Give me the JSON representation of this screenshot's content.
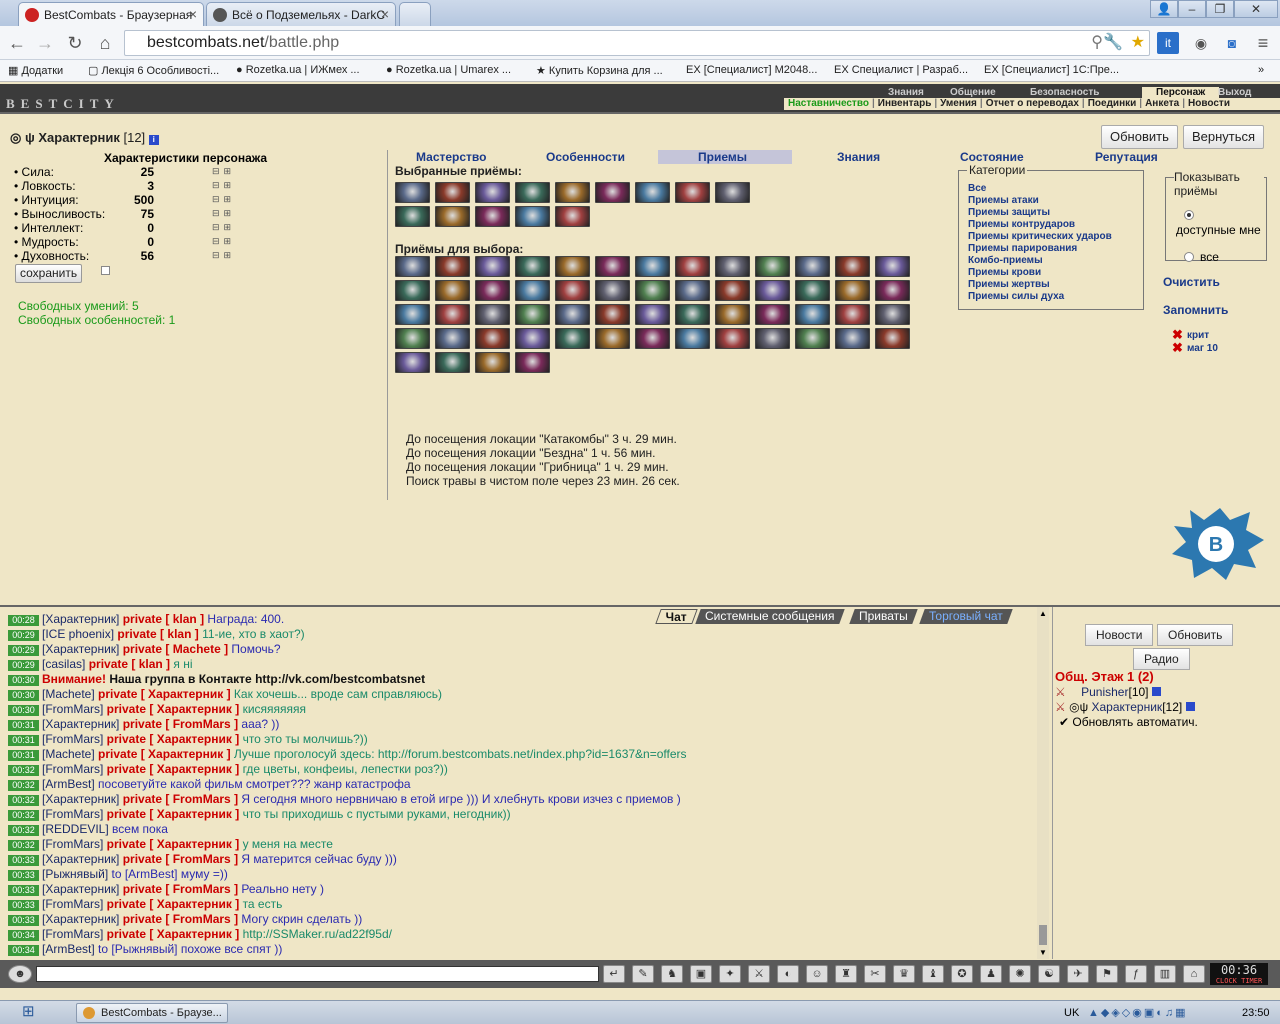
{
  "browser": {
    "tabs": [
      {
        "label": "BestCombats - Браузерная"
      },
      {
        "label": "Всё о Подземельях - DarkC"
      }
    ],
    "url_domain": "bestcombats.net",
    "url_path": "/battle.php",
    "bookmarks": [
      "Додатки",
      "Лекція 6 Особливості...",
      "Rozetka.ua | ИЖмех ...",
      "Rozetka.ua | Umarex ...",
      "Купить Корзина для ...",
      "[Специалист] M2048...",
      "Специалист | Разраб...",
      "[Специалист] 1С:Пре..."
    ]
  },
  "game": {
    "logo": "BESTCITY",
    "top_menu": [
      "Знания",
      "Общение",
      "Безопасность",
      "Персонаж",
      "Выход"
    ],
    "sub_menu": [
      "Наставничество",
      "Инвентарь",
      "Умения",
      "Отчет о переводах",
      "Поединки",
      "Анкета",
      "Новости"
    ],
    "character": {
      "name": "Характерник",
      "level": "[12]"
    },
    "buttons": {
      "refresh": "Обновить",
      "back": "Вернуться",
      "save": "сохранить"
    },
    "stats_title": "Характеристики персонажа",
    "stats": [
      {
        "name": "• Сила:",
        "value": "25"
      },
      {
        "name": "• Ловкость:",
        "value": "3"
      },
      {
        "name": "• Интуиция:",
        "value": "500"
      },
      {
        "name": "• Выносливость:",
        "value": "75"
      },
      {
        "name": "• Интеллект:",
        "value": "0"
      },
      {
        "name": "• Мудрость:",
        "value": "0"
      },
      {
        "name": "• Духовность:",
        "value": "56"
      }
    ],
    "free_skills": "Свободных умений: 5",
    "free_features": "Свободных особенностей: 1",
    "tabs": [
      "Мастерство",
      "Особенности",
      "Приемы",
      "Знания",
      "Состояние",
      "Репутация"
    ],
    "selected_title": "Выбранные приёмы:",
    "choose_title": "Приёмы для выбора:",
    "categories_title": "Категории",
    "categories": [
      "Все",
      "Приемы атаки",
      "Приемы защиты",
      "Приемы контрударов",
      "Приемы критических ударов",
      "Приемы парирования",
      "Комбо-приемы",
      "Приемы крови",
      "Приемы жертвы",
      "Приемы силы духа"
    ],
    "show_title": "Показывать приёмы",
    "show_opt1": "доступные мне",
    "show_opt2": "все",
    "clear": "Очистить",
    "remember": "Запомнить",
    "saved_sets": [
      "крит",
      "маг 10"
    ],
    "visits": [
      "До посещения локации \"Катакомбы\" 3 ч. 29 мин.",
      "До посещения локации \"Бездна\" 1 ч. 56 мин.",
      "До посещения локации \"Грибница\" 1 ч. 29 мин.",
      "Поиск травы в чистом поле через 23 мин. 26 сек."
    ]
  },
  "chat": {
    "tabs": [
      "Чат",
      "Системные сообщения",
      "Приваты",
      "Торговый чат"
    ],
    "messages": [
      {
        "time": "00:28",
        "user": "[Характерник]",
        "priv": "private [ klan ]",
        "text": "Награда: 400."
      },
      {
        "time": "00:29",
        "user": "[ICE phoenix]",
        "priv": "private [ klan ]",
        "text": "11-ие, хто в хаот?)"
      },
      {
        "time": "00:29",
        "user": "[Характерник]",
        "priv": "private [ Machete ]",
        "text": "Помочь?"
      },
      {
        "time": "00:29",
        "user": "[casilas]",
        "priv": "private [ klan ]",
        "text": "я ні"
      },
      {
        "time": "00:30",
        "user": "",
        "priv": "Внимание!",
        "text": "Наша группа в Контакте http://vk.com/bestcombatsnet"
      },
      {
        "time": "00:30",
        "user": "[Machete]",
        "priv": "private [ Характерник ]",
        "text": "Как хочешь... вроде сам справляюсь)"
      },
      {
        "time": "00:30",
        "user": "[FromMars]",
        "priv": "private [ Характерник ]",
        "text": "кисяяяяяяя"
      },
      {
        "time": "00:31",
        "user": "[Характерник]",
        "priv": "private [ FromMars ]",
        "text": "ааа? ))"
      },
      {
        "time": "00:31",
        "user": "[FromMars]",
        "priv": "private [ Характерник ]",
        "text": "что это ты молчишь?))"
      },
      {
        "time": "00:31",
        "user": "[Machete]",
        "priv": "private [ Характерник ]",
        "text": "Лучше проголосуй здесь: http://forum.bestcombats.net/index.php?id=1637&n=offers"
      },
      {
        "time": "00:32",
        "user": "[FromMars]",
        "priv": "private [ Характерник ]",
        "text": "где цветы, конфеиы, лепестки роз?))"
      },
      {
        "time": "00:32",
        "user": "[ArmBest]",
        "priv": "",
        "text": "посоветуйте какой фильм смотрет??? жанр катастрофа"
      },
      {
        "time": "00:32",
        "user": "[Характерник]",
        "priv": "private [ FromMars ]",
        "text": "Я сегодня много нервничаю в етой игре ))) И хлебнуть крови изчез с приемов )"
      },
      {
        "time": "00:32",
        "user": "[FromMars]",
        "priv": "private [ Характерник ]",
        "text": "что ты приходишь с пустыми руками, негодник))"
      },
      {
        "time": "00:32",
        "user": "[REDDEVIL]",
        "priv": "",
        "text": "всем пока"
      },
      {
        "time": "00:32",
        "user": "[FromMars]",
        "priv": "private [ Характерник ]",
        "text": "у меня на месте"
      },
      {
        "time": "00:33",
        "user": "[Характерник]",
        "priv": "private [ FromMars ]",
        "text": "Я матерится сейчас буду )))"
      },
      {
        "time": "00:33",
        "user": "[Рыжнявый]",
        "priv": "",
        "text": "to [ArmBest] муму =))"
      },
      {
        "time": "00:33",
        "user": "[Характерник]",
        "priv": "private [ FromMars ]",
        "text": "Реально нету )"
      },
      {
        "time": "00:33",
        "user": "[FromMars]",
        "priv": "private [ Характерник ]",
        "text": "та есть"
      },
      {
        "time": "00:33",
        "user": "[Характерник]",
        "priv": "private [ FromMars ]",
        "text": "Могу скрин сделать ))"
      },
      {
        "time": "00:34",
        "user": "[FromMars]",
        "priv": "private [ Характерник ]",
        "text": "http://SSMaker.ru/ad22f95d/"
      },
      {
        "time": "00:34",
        "user": "[ArmBest]",
        "priv": "",
        "text": "to [Рыжнявый] похоже все спят ))"
      }
    ],
    "right": {
      "news": "Новости",
      "refresh": "Обновить",
      "radio": "Радио",
      "location": "Общ. Этаж 1 (2)",
      "users": [
        {
          "name": "Punisher",
          "level": "[10]"
        },
        {
          "name": "Характерник",
          "level": "[12]"
        }
      ],
      "auto_refresh": "Обновлять автоматич."
    }
  },
  "toolbar": {
    "clock": "00:36",
    "clock_sub": "CLOCK TIMER"
  },
  "taskbar": {
    "task": "BestCombats - Браузе...",
    "lang": "UK",
    "time": "23:50"
  }
}
